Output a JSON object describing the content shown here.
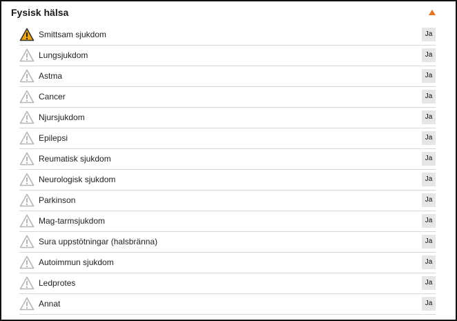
{
  "section": {
    "title": "Fysisk hälsa",
    "collapse_icon": "triangle-up-icon",
    "accent_color": "#e8731c"
  },
  "items": [
    {
      "label": "Smittsam sjukdom",
      "button": "Ja",
      "icon": "warning-icon",
      "state": "active"
    },
    {
      "label": "Lungsjukdom",
      "button": "Ja",
      "icon": "warning-icon",
      "state": "inactive"
    },
    {
      "label": "Astma",
      "button": "Ja",
      "icon": "warning-icon",
      "state": "inactive"
    },
    {
      "label": "Cancer",
      "button": "Ja",
      "icon": "warning-icon",
      "state": "inactive"
    },
    {
      "label": "Njursjukdom",
      "button": "Ja",
      "icon": "warning-icon",
      "state": "inactive"
    },
    {
      "label": "Epilepsi",
      "button": "Ja",
      "icon": "warning-icon",
      "state": "inactive"
    },
    {
      "label": "Reumatisk sjukdom",
      "button": "Ja",
      "icon": "warning-icon",
      "state": "inactive"
    },
    {
      "label": "Neurologisk sjukdom",
      "button": "Ja",
      "icon": "warning-icon",
      "state": "inactive"
    },
    {
      "label": "Parkinson",
      "button": "Ja",
      "icon": "warning-icon",
      "state": "inactive"
    },
    {
      "label": "Mag-tarmsjukdom",
      "button": "Ja",
      "icon": "warning-icon",
      "state": "inactive"
    },
    {
      "label": "Sura uppstötningar (halsbränna)",
      "button": "Ja",
      "icon": "warning-icon",
      "state": "inactive"
    },
    {
      "label": "Autoimmun sjukdom",
      "button": "Ja",
      "icon": "warning-icon",
      "state": "inactive"
    },
    {
      "label": "Ledprotes",
      "button": "Ja",
      "icon": "warning-icon",
      "state": "inactive"
    },
    {
      "label": "Annat",
      "button": "Ja",
      "icon": "warning-icon",
      "state": "inactive"
    }
  ],
  "colors": {
    "warning_active_fill": "#f0a30a",
    "warning_active_stroke": "#333333",
    "warning_inactive_stroke": "#b5b5b5",
    "button_bg": "#e6e6e6"
  }
}
